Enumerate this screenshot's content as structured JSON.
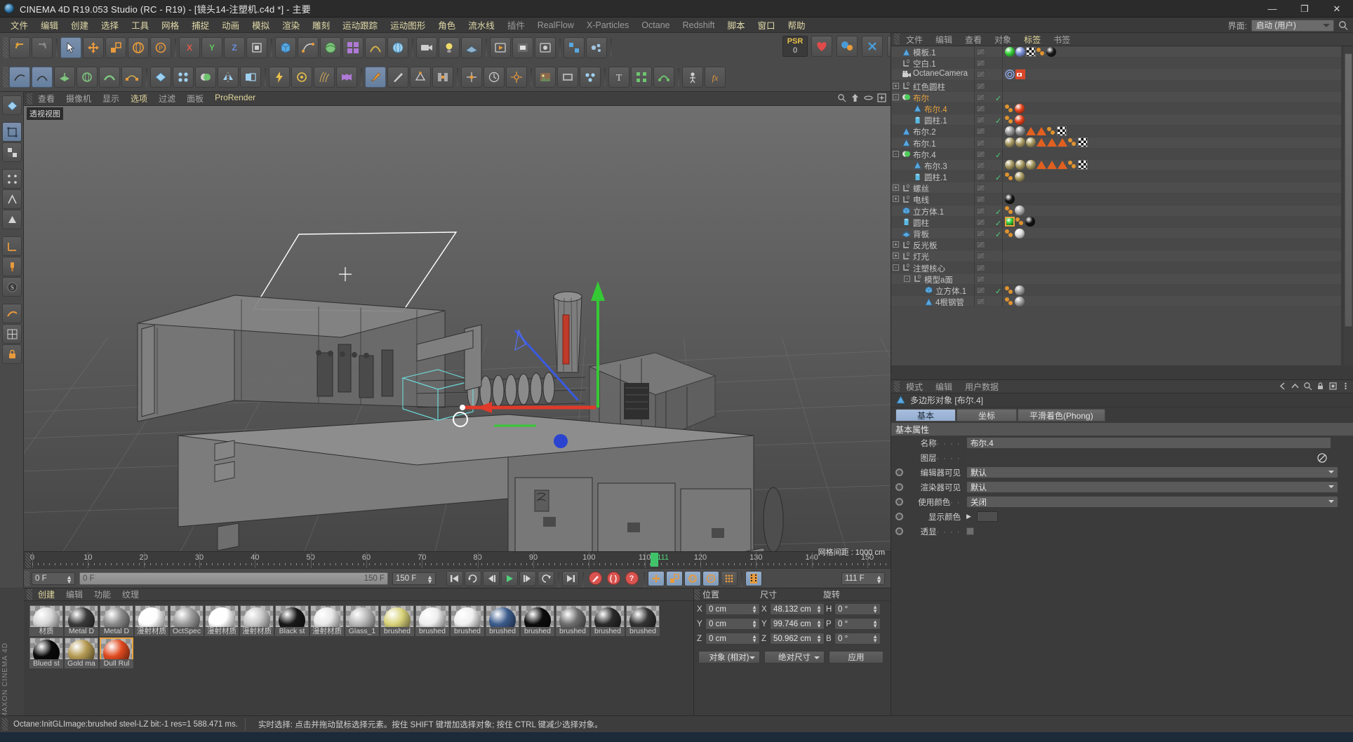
{
  "window": {
    "title": "CINEMA 4D R19.053 Studio (RC - R19) - [镜头14-注塑机.c4d *] - 主要",
    "minimize": "—",
    "maximize": "❐",
    "close": "✕"
  },
  "menubar": {
    "items": [
      {
        "label": "文件",
        "highlight": true
      },
      {
        "label": "编辑",
        "highlight": true
      },
      {
        "label": "创建",
        "highlight": true
      },
      {
        "label": "选择",
        "highlight": true
      },
      {
        "label": "工具",
        "highlight": true
      },
      {
        "label": "网格",
        "highlight": true
      },
      {
        "label": "捕捉",
        "highlight": true
      },
      {
        "label": "动画",
        "highlight": true
      },
      {
        "label": "模拟",
        "highlight": true
      },
      {
        "label": "渲染",
        "highlight": true
      },
      {
        "label": "雕刻",
        "highlight": true
      },
      {
        "label": "运动跟踪",
        "highlight": true
      },
      {
        "label": "运动图形",
        "highlight": true
      },
      {
        "label": "角色",
        "highlight": true
      },
      {
        "label": "流水线",
        "highlight": true
      },
      {
        "label": "插件",
        "highlight": false
      },
      {
        "label": "RealFlow",
        "highlight": false
      },
      {
        "label": "X-Particles",
        "highlight": false
      },
      {
        "label": "Octane",
        "highlight": false
      },
      {
        "label": "Redshift",
        "highlight": false
      },
      {
        "label": "脚本",
        "highlight": true
      },
      {
        "label": "窗口",
        "highlight": true
      },
      {
        "label": "帮助",
        "highlight": true
      }
    ],
    "layout_label": "界面:",
    "layout_value": "启动 (用户)"
  },
  "viewport": {
    "menu": [
      {
        "label": "查看",
        "highlight": false
      },
      {
        "label": "摄像机",
        "highlight": false
      },
      {
        "label": "显示",
        "highlight": false
      },
      {
        "label": "选项",
        "highlight": true
      },
      {
        "label": "过滤",
        "highlight": false
      },
      {
        "label": "面板",
        "highlight": false
      },
      {
        "label": "ProRender",
        "highlight": true
      }
    ],
    "view_label": "透视视图",
    "grid_note": "网格间距 : 1000 cm"
  },
  "timeline": {
    "ticks": [
      "0",
      "10",
      "20",
      "30",
      "40",
      "50",
      "60",
      "70",
      "80",
      "90",
      "100",
      "110",
      "120",
      "130",
      "140",
      "150"
    ],
    "current_frame_marker": "111",
    "current_frame_field": "0 F",
    "range_start": "0 F",
    "range_end": "150 F",
    "end_field": "150 F",
    "frame_readout": "111 F"
  },
  "material_manager": {
    "menu": [
      {
        "label": "创建",
        "highlight": true
      },
      {
        "label": "编辑",
        "highlight": false
      },
      {
        "label": "功能",
        "highlight": false
      },
      {
        "label": "纹理",
        "highlight": false
      }
    ],
    "materials": [
      {
        "name": "材质",
        "color": "#d6d6d6",
        "selected": false
      },
      {
        "name": "Metal D",
        "color": "#3a3a3a",
        "selected": false
      },
      {
        "name": "Metal D",
        "color": "#8a8a8a",
        "selected": false
      },
      {
        "name": "漫射材质",
        "color": "#fdfdfd",
        "selected": false
      },
      {
        "name": "OctSpec",
        "color": "#9a9a9a",
        "selected": false
      },
      {
        "name": "漫射材质",
        "color": "#ffffff",
        "selected": false
      },
      {
        "name": "漫射材质",
        "color": "#c9c9c9",
        "selected": false
      },
      {
        "name": "Black st",
        "color": "#191919",
        "selected": false
      },
      {
        "name": "漫射材质",
        "color": "#e8e8e8",
        "selected": false
      },
      {
        "name": "Glass_1",
        "color": "#b8b8b8",
        "selected": false
      },
      {
        "name": "brushed",
        "color": "#d8d27a",
        "selected": false
      },
      {
        "name": "brushed",
        "color": "#eeeeee",
        "selected": false
      },
      {
        "name": "brushed",
        "color": "#efefef",
        "selected": false
      },
      {
        "name": "brushed",
        "color": "#3c5c8c",
        "selected": false
      },
      {
        "name": "brushed",
        "color": "#0c0c0c",
        "selected": false
      },
      {
        "name": "brushed",
        "color": "#6d6d6d",
        "selected": false
      },
      {
        "name": "brushed",
        "color": "#2a2a2a",
        "selected": false
      },
      {
        "name": "brushed",
        "color": "#333333",
        "selected": false
      },
      {
        "name": "Blued st",
        "color": "#0a0a0a",
        "selected": false
      },
      {
        "name": "Gold ma",
        "color": "#b49a53",
        "selected": false
      },
      {
        "name": "Dull Rul",
        "color": "#e04a20",
        "selected": true
      }
    ]
  },
  "coordinates": {
    "headers": {
      "position": "位置",
      "size": "尺寸",
      "rotation": "旋转"
    },
    "rows": [
      {
        "axis": "X",
        "position": "0 cm",
        "size_axis": "X",
        "size": "48.132 cm",
        "rot_axis": "H",
        "rotation": "0 °"
      },
      {
        "axis": "Y",
        "position": "0 cm",
        "size_axis": "Y",
        "size": "99.746 cm",
        "rot_axis": "P",
        "rotation": "0 °"
      },
      {
        "axis": "Z",
        "position": "0 cm",
        "size_axis": "Z",
        "size": "50.962 cm",
        "rot_axis": "B",
        "rotation": "0 °"
      }
    ],
    "mode_dropdown": "对象 (相对)",
    "size_dropdown": "绝对尺寸",
    "apply_button": "应用"
  },
  "object_manager": {
    "menu": [
      {
        "label": "文件",
        "highlight": false
      },
      {
        "label": "编辑",
        "highlight": false
      },
      {
        "label": "查看",
        "highlight": false
      },
      {
        "label": "对象",
        "highlight": false
      },
      {
        "label": "标签",
        "highlight": true
      },
      {
        "label": "书签",
        "highlight": false
      }
    ],
    "objects": [
      {
        "name": "模板.1",
        "icon": "polygon",
        "depth": 1,
        "expander": "",
        "selected": false,
        "tick": "",
        "dot": "grey",
        "tags": [
          {
            "t": "ball",
            "c": "#37d13b"
          },
          {
            "t": "ball",
            "c": "#7a8fd6"
          },
          {
            "t": "checker"
          },
          {
            "t": "dots"
          },
          {
            "t": "ball",
            "c": "#1a1a1a"
          }
        ]
      },
      {
        "name": "空白.1",
        "icon": "null",
        "depth": 1,
        "expander": "",
        "selected": false,
        "tick": "",
        "dot": "grey",
        "tags": []
      },
      {
        "name": "OctaneCamera",
        "icon": "camera",
        "depth": 1,
        "expander": "",
        "selected": false,
        "tick": "",
        "dot": "target",
        "tags": [
          {
            "t": "target"
          },
          {
            "t": "cam"
          }
        ]
      },
      {
        "name": "红色圆柱",
        "icon": "null",
        "depth": 1,
        "expander": "+",
        "selected": false,
        "tick": "",
        "dot": "grey",
        "tags": []
      },
      {
        "name": "布尔",
        "icon": "bool",
        "depth": 1,
        "expander": "-",
        "selected": true,
        "tick": "✓",
        "dot": "grey",
        "tags": []
      },
      {
        "name": "布尔.4",
        "icon": "polygon",
        "depth": 2,
        "expander": "",
        "selected": true,
        "tick": "",
        "dot": "grey",
        "tags": [
          {
            "t": "dots"
          },
          {
            "t": "ball",
            "c": "#e8441c"
          }
        ]
      },
      {
        "name": "圆柱.1",
        "icon": "cylinder",
        "depth": 2,
        "expander": "",
        "selected": false,
        "tick": "✓",
        "dot": "grey",
        "tags": [
          {
            "t": "dots"
          },
          {
            "t": "ball",
            "c": "#e8441c"
          }
        ]
      },
      {
        "name": "布尔.2",
        "icon": "polygon",
        "depth": 1,
        "expander": "",
        "selected": false,
        "tick": "",
        "dot": "grey",
        "tags": [
          {
            "t": "ball",
            "c": "#9a9a9a"
          },
          {
            "t": "ball",
            "c": "#8c8c8c"
          },
          {
            "t": "tri"
          },
          {
            "t": "tri"
          },
          {
            "t": "dots"
          },
          {
            "t": "checker"
          }
        ]
      },
      {
        "name": "布尔.1",
        "icon": "polygon",
        "depth": 1,
        "expander": "",
        "selected": false,
        "tick": "",
        "dot": "grey",
        "tags": [
          {
            "t": "ball",
            "c": "#a89a62"
          },
          {
            "t": "ball",
            "c": "#a89a62"
          },
          {
            "t": "ball",
            "c": "#a89a62"
          },
          {
            "t": "tri"
          },
          {
            "t": "tri"
          },
          {
            "t": "tri"
          },
          {
            "t": "dots"
          },
          {
            "t": "checker"
          }
        ]
      },
      {
        "name": "布尔.4",
        "icon": "bool",
        "depth": 1,
        "expander": "-",
        "selected": false,
        "tick": "✓",
        "dot": "grey",
        "tags": []
      },
      {
        "name": "布尔.3",
        "icon": "polygon",
        "depth": 2,
        "expander": "",
        "selected": false,
        "tick": "",
        "dot": "grey",
        "tags": [
          {
            "t": "ball",
            "c": "#a89a62"
          },
          {
            "t": "ball",
            "c": "#a89a62"
          },
          {
            "t": "ball",
            "c": "#a89a62"
          },
          {
            "t": "tri"
          },
          {
            "t": "tri"
          },
          {
            "t": "tri"
          },
          {
            "t": "dots"
          },
          {
            "t": "checker"
          }
        ]
      },
      {
        "name": "圆柱.1",
        "icon": "cylinder",
        "depth": 2,
        "expander": "",
        "selected": false,
        "tick": "✓",
        "dot": "grey",
        "tags": [
          {
            "t": "dots"
          },
          {
            "t": "ball",
            "c": "#a89a62"
          }
        ]
      },
      {
        "name": "螺丝",
        "icon": "null",
        "depth": 1,
        "expander": "+",
        "selected": false,
        "tick": "",
        "dot": "grey",
        "tags": []
      },
      {
        "name": "电线",
        "icon": "null",
        "depth": 1,
        "expander": "+",
        "selected": false,
        "tick": "",
        "dot": "grey",
        "tags": [
          {
            "t": "ball",
            "c": "#151515"
          }
        ]
      },
      {
        "name": "立方体.1",
        "icon": "cube",
        "depth": 1,
        "expander": "",
        "selected": false,
        "tick": "✓",
        "dot": "grey",
        "tags": [
          {
            "t": "dots"
          },
          {
            "t": "ball",
            "c": "#b0b0b0"
          }
        ]
      },
      {
        "name": "圆柱",
        "icon": "cylinder",
        "depth": 1,
        "expander": "",
        "selected": false,
        "tick": "✓",
        "dot": "grey",
        "tags": [
          {
            "t": "ballsel",
            "c": "#37d13b"
          },
          {
            "t": "dots"
          },
          {
            "t": "ball",
            "c": "#141414"
          }
        ]
      },
      {
        "name": "背板",
        "icon": "plane",
        "depth": 1,
        "expander": "",
        "selected": false,
        "tick": "✓",
        "dot": "grey",
        "tags": [
          {
            "t": "dots"
          },
          {
            "t": "ball",
            "c": "#dcdcdc"
          }
        ]
      },
      {
        "name": "反光板",
        "icon": "null",
        "depth": 1,
        "expander": "+",
        "selected": false,
        "tick": "",
        "dot": "red",
        "tags": []
      },
      {
        "name": "灯光",
        "icon": "null",
        "depth": 1,
        "expander": "+",
        "selected": false,
        "tick": "",
        "dot": "grey",
        "tags": []
      },
      {
        "name": "注塑核心",
        "icon": "null",
        "depth": 1,
        "expander": "-",
        "selected": false,
        "tick": "",
        "dot": "grey",
        "tags": []
      },
      {
        "name": "模型a面",
        "icon": "null",
        "depth": 2,
        "expander": "-",
        "selected": false,
        "tick": "",
        "dot": "grey",
        "tags": []
      },
      {
        "name": "立方体.1",
        "icon": "cube",
        "depth": 3,
        "expander": "",
        "selected": false,
        "tick": "✓",
        "dot": "grey",
        "tags": [
          {
            "t": "dots"
          },
          {
            "t": "ball",
            "c": "#9e9e9e"
          }
        ]
      },
      {
        "name": "4根钢管",
        "icon": "polygon",
        "depth": 3,
        "expander": "",
        "selected": false,
        "tick": "",
        "dot": "grey",
        "tags": [
          {
            "t": "dots"
          },
          {
            "t": "ball",
            "c": "#9e9e9e"
          }
        ]
      }
    ]
  },
  "attribute_manager": {
    "menu": [
      {
        "label": "模式",
        "highlight": false
      },
      {
        "label": "编辑",
        "highlight": false
      },
      {
        "label": "用户数据",
        "highlight": false
      }
    ],
    "object_title": "多边形对象 [布尔.4]",
    "tabs": [
      {
        "label": "基本",
        "active": true
      },
      {
        "label": "坐标",
        "active": false
      },
      {
        "label": "平滑着色(Phong)",
        "active": false
      }
    ],
    "section_title": "基本属性",
    "fields": [
      {
        "label": "名称",
        "dots": "· · · ·",
        "value": "布尔.4",
        "type": "text",
        "radio": false
      },
      {
        "label": "图层",
        "dots": "· · · ·",
        "value": "",
        "type": "layer",
        "radio": false
      },
      {
        "label": "编辑器可见",
        "dots": "",
        "value": "默认",
        "type": "select",
        "radio": true
      },
      {
        "label": "渲染器可见",
        "dots": "",
        "value": "默认",
        "type": "select",
        "radio": true
      },
      {
        "label": "使用颜色",
        "dots": "· ·",
        "value": "关闭",
        "type": "select",
        "radio": true
      },
      {
        "label": "显示颜色",
        "dots": "",
        "value": "",
        "type": "color",
        "radio": true
      },
      {
        "label": "透显",
        "dots": "· · · ·",
        "value": "",
        "type": "check",
        "radio": true
      }
    ]
  },
  "statusbar": {
    "render_info": "Octane:InitGLImage:brushed steel-LZ  bit:-1 res=1  588.471 ms.",
    "hint": "实时选择:  点击并拖动鼠标选择元素。按住 SHIFT 键增加选择对象; 按住 CTRL 键减少选择对象。"
  },
  "psr": {
    "label": "PSR",
    "value": "0"
  },
  "maxon": "MAXON CINEMA 4D",
  "colors": {
    "accent_orange": "#e8a33d",
    "menu_yellow": "#e0d9a8",
    "tick_green": "#4fd07a",
    "tab_blue": "#a8bedd",
    "panel_bg": "#3d3d3d",
    "toolbar_bg": "#4a4a4a",
    "axis_x_red": "#e04030",
    "axis_y_green": "#40c040",
    "axis_z_blue": "#3050e0"
  }
}
